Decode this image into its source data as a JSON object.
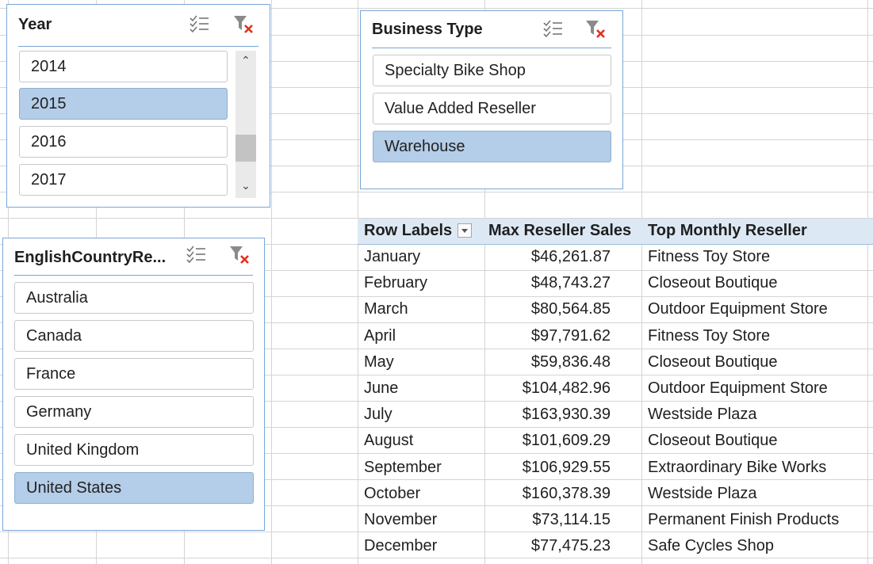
{
  "slicers": {
    "year": {
      "title": "Year",
      "items": [
        "2014",
        "2015",
        "2016",
        "2017"
      ],
      "selected": "2015"
    },
    "business_type": {
      "title": "Business Type",
      "items": [
        "Specialty Bike Shop",
        "Value Added Reseller",
        "Warehouse"
      ],
      "selected": "Warehouse"
    },
    "country": {
      "title": "EnglishCountryRe...",
      "items": [
        "Australia",
        "Canada",
        "France",
        "Germany",
        "United Kingdom",
        "United States"
      ],
      "selected": "United States"
    }
  },
  "icons": {
    "multi_select": "multi-select-icon",
    "clear_filter": "clear-filter-icon"
  },
  "colors": {
    "selected_item": "#b4cde8",
    "slicer_border": "#7aa6d6",
    "pivot_header": "#dce9f5",
    "clear_filter_x": "#e0301e"
  },
  "pivot": {
    "headers": {
      "row_labels": "Row Labels",
      "max_sales": "Max Reseller Sales",
      "top_reseller": "Top Monthly Reseller"
    },
    "rows": [
      {
        "month": "January",
        "sales": "$46,261.87",
        "reseller": "Fitness Toy Store"
      },
      {
        "month": "February",
        "sales": "$48,743.27",
        "reseller": "Closeout Boutique"
      },
      {
        "month": "March",
        "sales": "$80,564.85",
        "reseller": "Outdoor Equipment Store"
      },
      {
        "month": "April",
        "sales": "$97,791.62",
        "reseller": "Fitness Toy Store"
      },
      {
        "month": "May",
        "sales": "$59,836.48",
        "reseller": "Closeout Boutique"
      },
      {
        "month": "June",
        "sales": "$104,482.96",
        "reseller": "Outdoor Equipment Store"
      },
      {
        "month": "July",
        "sales": "$163,930.39",
        "reseller": "Westside Plaza"
      },
      {
        "month": "August",
        "sales": "$101,609.29",
        "reseller": "Closeout Boutique"
      },
      {
        "month": "September",
        "sales": "$106,929.55",
        "reseller": "Extraordinary Bike Works"
      },
      {
        "month": "October",
        "sales": "$160,378.39",
        "reseller": "Westside Plaza"
      },
      {
        "month": "November",
        "sales": "$73,114.15",
        "reseller": "Permanent Finish Products"
      },
      {
        "month": "December",
        "sales": "$77,475.23",
        "reseller": "Safe Cycles Shop"
      }
    ]
  }
}
